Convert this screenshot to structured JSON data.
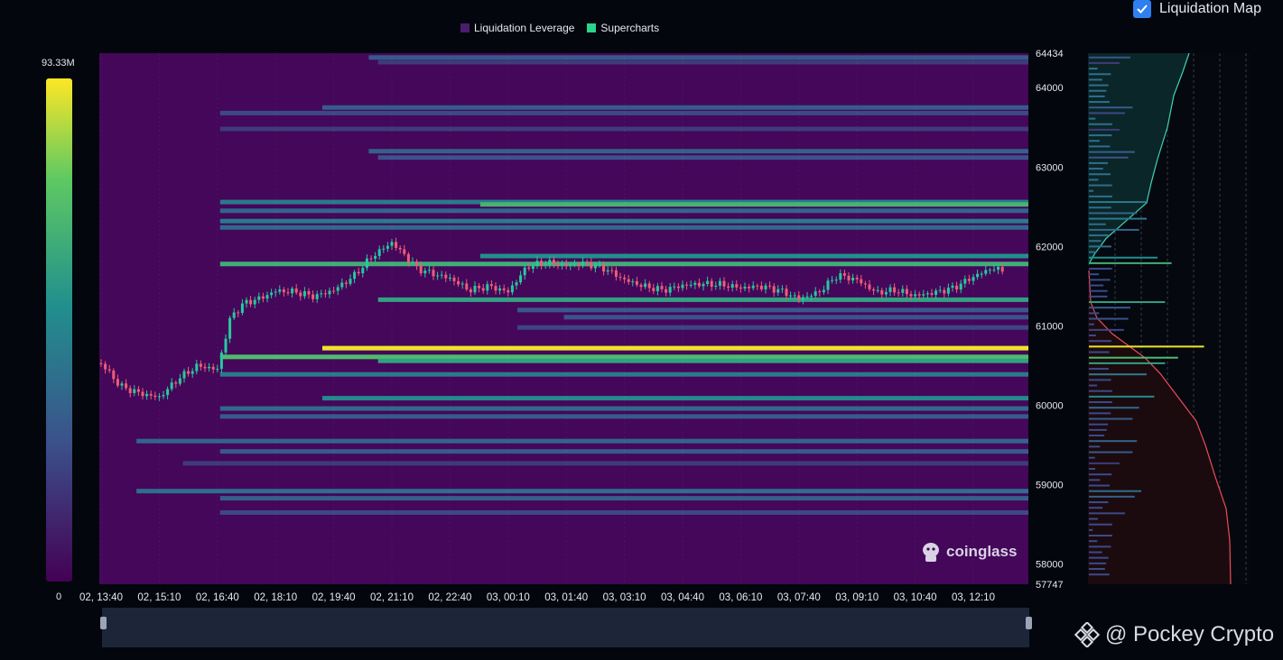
{
  "legend": {
    "items": [
      {
        "label": "Liquidation Leverage",
        "color": "#4a1d6e"
      },
      {
        "label": "Supercharts",
        "color": "#2ad58e"
      }
    ]
  },
  "toggle": {
    "label": "Liquidation Map",
    "checked": true
  },
  "colorscale": {
    "max_label": "93.33M",
    "min_label": "0"
  },
  "watermark": "coinglass",
  "brand": "@ Pockey Crypto",
  "chart_data": {
    "type": "heatmap",
    "title": "",
    "y_range": [
      57747,
      64434
    ],
    "y_ticks": [
      "64434",
      "64000",
      "63000",
      "62000",
      "61000",
      "60000",
      "59000",
      "58000",
      "57747"
    ],
    "x_ticks": [
      "02, 13:40",
      "02, 15:10",
      "02, 16:40",
      "02, 18:10",
      "02, 19:40",
      "02, 21:10",
      "02, 22:40",
      "03, 00:10",
      "03, 01:40",
      "03, 03:10",
      "03, 04:40",
      "03, 06:10",
      "03, 07:40",
      "03, 09:10",
      "03, 10:40",
      "03, 12:10"
    ],
    "liquidation_bands": [
      {
        "price": 64380,
        "start": 0.29,
        "intensity": 0.3
      },
      {
        "price": 64320,
        "start": 0.3,
        "intensity": 0.2
      },
      {
        "price": 63750,
        "start": 0.24,
        "intensity": 0.32
      },
      {
        "price": 63680,
        "start": 0.13,
        "intensity": 0.25
      },
      {
        "price": 63480,
        "start": 0.13,
        "intensity": 0.2
      },
      {
        "price": 63200,
        "start": 0.29,
        "intensity": 0.34
      },
      {
        "price": 63120,
        "start": 0.3,
        "intensity": 0.28
      },
      {
        "price": 62560,
        "start": 0.13,
        "intensity": 0.45
      },
      {
        "price": 62530,
        "start": 0.41,
        "intensity": 0.7
      },
      {
        "price": 62450,
        "start": 0.13,
        "intensity": 0.36
      },
      {
        "price": 62320,
        "start": 0.13,
        "intensity": 0.45
      },
      {
        "price": 62240,
        "start": 0.13,
        "intensity": 0.38
      },
      {
        "price": 61880,
        "start": 0.41,
        "intensity": 0.55
      },
      {
        "price": 61780,
        "start": 0.13,
        "intensity": 0.68
      },
      {
        "price": 61330,
        "start": 0.3,
        "intensity": 0.62
      },
      {
        "price": 61200,
        "start": 0.45,
        "intensity": 0.3
      },
      {
        "price": 61110,
        "start": 0.5,
        "intensity": 0.28
      },
      {
        "price": 60980,
        "start": 0.45,
        "intensity": 0.24
      },
      {
        "price": 60720,
        "start": 0.24,
        "intensity": 0.98
      },
      {
        "price": 60610,
        "start": 0.13,
        "intensity": 0.74
      },
      {
        "price": 60560,
        "start": 0.3,
        "intensity": 0.62
      },
      {
        "price": 60390,
        "start": 0.13,
        "intensity": 0.45
      },
      {
        "price": 60090,
        "start": 0.24,
        "intensity": 0.52
      },
      {
        "price": 59960,
        "start": 0.13,
        "intensity": 0.38
      },
      {
        "price": 59860,
        "start": 0.13,
        "intensity": 0.32
      },
      {
        "price": 59550,
        "start": 0.04,
        "intensity": 0.36
      },
      {
        "price": 59420,
        "start": 0.13,
        "intensity": 0.32
      },
      {
        "price": 59270,
        "start": 0.09,
        "intensity": 0.2
      },
      {
        "price": 58920,
        "start": 0.04,
        "intensity": 0.4
      },
      {
        "price": 58830,
        "start": 0.13,
        "intensity": 0.34
      },
      {
        "price": 58650,
        "start": 0.13,
        "intensity": 0.25
      }
    ],
    "price_series": [
      [
        "02, 13:40",
        60530
      ],
      [
        "02, 14:10",
        60240
      ],
      [
        "02, 14:40",
        60150
      ],
      [
        "02, 15:10",
        60100
      ],
      [
        "02, 15:40",
        60340
      ],
      [
        "02, 16:10",
        60500
      ],
      [
        "02, 16:40",
        60450
      ],
      [
        "02, 17:00",
        61100
      ],
      [
        "02, 17:20",
        61280
      ],
      [
        "02, 17:50",
        61360
      ],
      [
        "02, 18:10",
        61440
      ],
      [
        "02, 18:40",
        61430
      ],
      [
        "02, 19:10",
        61370
      ],
      [
        "02, 19:40",
        61450
      ],
      [
        "02, 20:10",
        61620
      ],
      [
        "02, 20:40",
        61880
      ],
      [
        "02, 21:10",
        62050
      ],
      [
        "02, 21:30",
        61890
      ],
      [
        "02, 21:50",
        61720
      ],
      [
        "02, 22:20",
        61640
      ],
      [
        "02, 22:40",
        61600
      ],
      [
        "02, 23:10",
        61450
      ],
      [
        "02, 23:40",
        61500
      ],
      [
        "03, 00:10",
        61430
      ],
      [
        "03, 00:40",
        61750
      ],
      [
        "03, 01:10",
        61800
      ],
      [
        "03, 01:40",
        61760
      ],
      [
        "03, 02:10",
        61790
      ],
      [
        "03, 02:40",
        61720
      ],
      [
        "03, 03:10",
        61580
      ],
      [
        "03, 03:40",
        61500
      ],
      [
        "03, 04:10",
        61450
      ],
      [
        "03, 04:40",
        61510
      ],
      [
        "03, 05:10",
        61530
      ],
      [
        "03, 05:40",
        61520
      ],
      [
        "03, 06:10",
        61480
      ],
      [
        "03, 06:40",
        61500
      ],
      [
        "03, 07:10",
        61450
      ],
      [
        "03, 07:40",
        61340
      ],
      [
        "03, 08:10",
        61420
      ],
      [
        "03, 08:40",
        61640
      ],
      [
        "03, 09:10",
        61580
      ],
      [
        "03, 09:40",
        61420
      ],
      [
        "03, 10:10",
        61450
      ],
      [
        "03, 10:40",
        61380
      ],
      [
        "03, 11:10",
        61420
      ],
      [
        "03, 11:40",
        61480
      ],
      [
        "03, 12:10",
        61620
      ],
      [
        "03, 12:40",
        61730
      ],
      [
        "03, 13:00",
        61680
      ]
    ],
    "cumulative_long_side": "red",
    "cumulative_short_side": "teal",
    "grid": false
  }
}
